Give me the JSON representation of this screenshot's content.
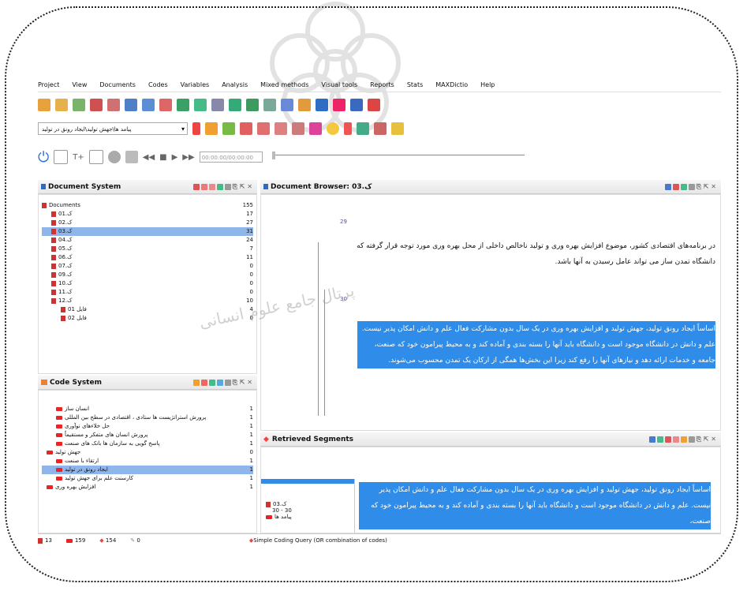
{
  "menubar": [
    "Project",
    "View",
    "Documents",
    "Codes",
    "Variables",
    "Analysis",
    "Mixed methods",
    "Visual tools",
    "Reports",
    "Stats",
    "MAXDictio",
    "Help"
  ],
  "toolbar": {
    "active_code_combo": "پیامد ها\\جهش تولید\\ایجاد رونق در تولید",
    "timecode": "00:00:00/00:00:00"
  },
  "document_system": {
    "title": "Document System",
    "root": {
      "label": "Documents",
      "count": "155"
    },
    "items": [
      {
        "label": "01.ک",
        "count": "17"
      },
      {
        "label": "02.ک",
        "count": "27"
      },
      {
        "label": "03.ک",
        "count": "31"
      },
      {
        "label": "04.ک",
        "count": "24"
      },
      {
        "label": "05.ک",
        "count": "7"
      },
      {
        "label": "06.ک",
        "count": "11"
      },
      {
        "label": "07.ک",
        "count": "0"
      },
      {
        "label": "09.ک",
        "count": "0"
      },
      {
        "label": "10.ک",
        "count": "0"
      },
      {
        "label": "11.ک",
        "count": "0"
      },
      {
        "label": "12.ک",
        "count": "10"
      },
      {
        "label": "فایل 01",
        "count": "4"
      },
      {
        "label": "فایل 02",
        "count": "0"
      }
    ]
  },
  "code_system": {
    "title": "Code System",
    "items": [
      {
        "label": "انسان ساز",
        "count": "1"
      },
      {
        "label": "پرورش استراتژیست ها ستادی ، اقتصادی در سطح بین المللی",
        "count": "1"
      },
      {
        "label": "حل خلاءهای نوآوری",
        "count": "1"
      },
      {
        "label": "پرورش انسان های متفکر و مستقیماً",
        "count": "1"
      },
      {
        "label": "پاسخ گویی به سازمان ها بانک های صنعت",
        "count": "1"
      },
      {
        "label": "جهش تولید",
        "count": "0"
      },
      {
        "label": "ارتقاء با صنعت",
        "count": "1"
      },
      {
        "label": "ایجاد رونق در تولید",
        "count": "1"
      },
      {
        "label": "کارسنت علم برای جهش تولید",
        "count": "1"
      },
      {
        "label": "افزایش بهره وری",
        "count": "1"
      }
    ]
  },
  "document_browser": {
    "title": "Document Browser: 03.ک",
    "line_a": "29",
    "para_1": "در برنامه‌های اقتصادی کشور، موضوع افزایش بهره وری و تولید ناخالص داخلی از محل بهره وری مورد توجه قرار گرفته که دانشگاه تمدن ساز می تواند عامل رسیدن به آنها باشد.",
    "line_b": "30",
    "para_2": "اساساً ایجاد رونق تولید، جهش تولید و افزایش بهره وری در یک سال بدون مشارکت فعال علم و دانش امکان پذیر نیست. علم و دانش در دانشگاه موجود است و دانشگاه باید آنها را بسته بندی و آماده کند و به محیط پیرامون خود که صنعت، جامعه و خدمات ارائه دهد و نیازهای آنها را رفع کند زیرا این بخش‌ها همگی از ارکان یک تمدن محسوب می‌شوند."
  },
  "retrieved_segments": {
    "title": "Retrieved Segments",
    "doc_label": "03.ک",
    "range": "30 - 30",
    "code_label": "پیامد ها",
    "text": "اساساً ایجاد رونق تولید، جهش تولید و افزایش بهره وری در یک سال بدون مشارکت فعال علم و دانش امکان پذیر نیست. علم و دانش در دانشگاه موجود است و دانشگاه باید آنها را بسته بندی و آماده کند و به محیط پیرامون خود که صنعت،"
  },
  "statusbar": {
    "docs": "13",
    "codes": "159",
    "segments": "154",
    "zero": "0",
    "query": "Simple Coding Query (OR combination of codes)"
  },
  "watermark": "پرتال جامع علوم انسانی"
}
